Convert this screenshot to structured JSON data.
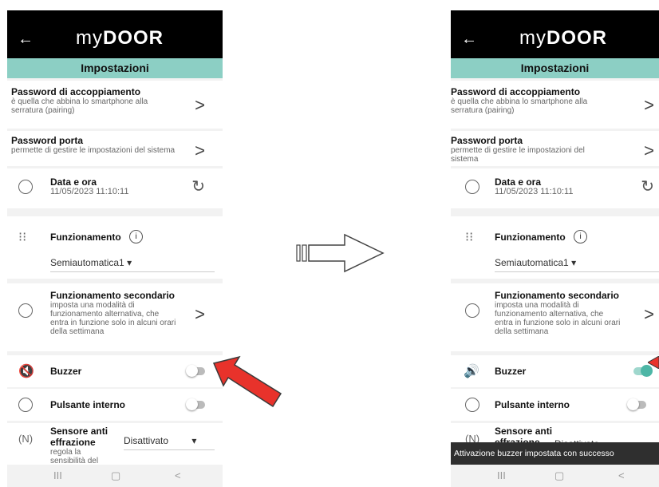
{
  "app": {
    "back_icon": "arrow-left-icon",
    "logo_thin": "my",
    "logo_bold": "DOOR",
    "header_title": "Impostazioni"
  },
  "settings": {
    "pairing_title": "Password di accoppiamento",
    "pairing_sub": "è quella che abbina lo smartphone alla serratura (pairing)",
    "door_pw_title": "Password porta",
    "door_pw_sub": "permette di gestire le impostazioni del sistema",
    "datetime_title": "Data e ora",
    "datetime_value": "11/05/2023 11:10:11",
    "mode_title": "Funzionamento",
    "mode_value": "Semiautomatica1",
    "secondary_title": "Funzionamento secondario",
    "secondary_sub": "imposta una modalità di funzionamento alternativa, che entra in funzione solo in alcuni orari della settimana",
    "buzzer_title": "Buzzer",
    "internal_button_title": "Pulsante interno",
    "sensor_title": "Sensore anti effrazione",
    "sensor_title_1": "Sensore anti",
    "sensor_title_2": "effrazione",
    "sensor_sub": "regola la sensibilità del",
    "sensor_sub_1": "regola la",
    "sensor_sub_2": "sensibilità del",
    "sensor_value": "Disattivato",
    "sensor_value_cut": "Disattivato"
  },
  "states": {
    "left_buzzer_on": false,
    "right_buzzer_on": true,
    "internal_button_on": false
  },
  "snackbar": {
    "message": "Attivazione buzzer impostata con successo"
  },
  "nav": {
    "recent": "III",
    "home": "▢",
    "back": "<"
  },
  "colors": {
    "header_bg": "#000000",
    "title_bar": "#8ccfc4",
    "toggle_on": "#4db6a6",
    "arrow_red": "#e8322b"
  }
}
